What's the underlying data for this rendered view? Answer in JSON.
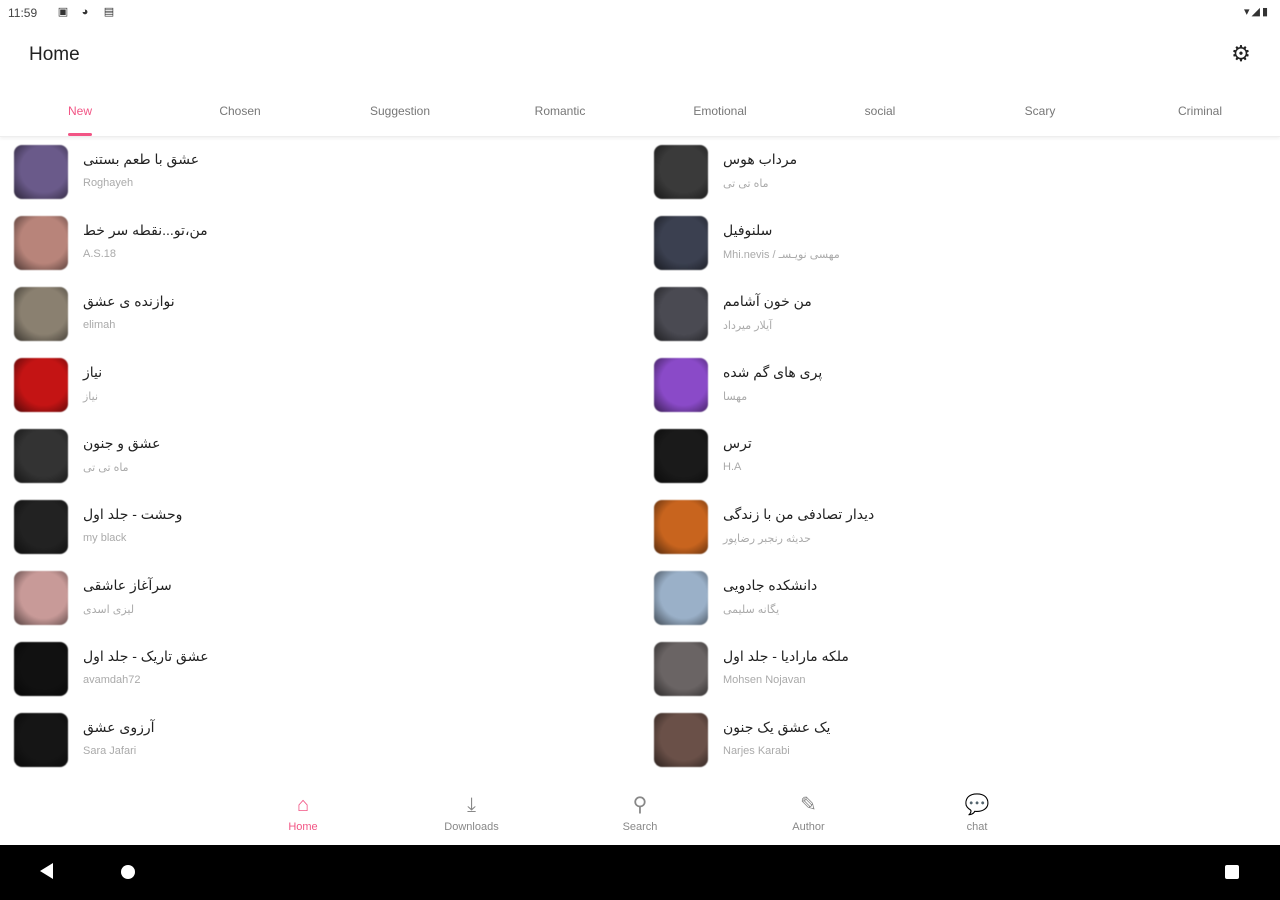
{
  "status": {
    "time": "11:59",
    "icons": [
      "notification-icon",
      "vpn-icon",
      "sim-icon"
    ],
    "right_icons": [
      "wifi-icon",
      "signal-icon",
      "battery-icon"
    ]
  },
  "appbar": {
    "title": "Home",
    "settings_icon": "gear-icon"
  },
  "tabs": [
    "New",
    "Chosen",
    "Suggestion",
    "Romantic",
    "Emotional",
    "social",
    "Scary",
    "Criminal"
  ],
  "active_tab": 0,
  "accent": "#f25585",
  "books_left": [
    {
      "title": "عشق با طعم بستنی",
      "author": "Roghayeh",
      "color": "#6a5a8a"
    },
    {
      "title": "من،تو...نقطه سر خط",
      "author": "A.S.18",
      "color": "#b8847a"
    },
    {
      "title": "نوازنده ی عشق",
      "author": "elimah",
      "color": "#8a8070"
    },
    {
      "title": "نیاز",
      "author": "نیاز",
      "color": "#c41414"
    },
    {
      "title": "عشق و جنون",
      "author": "ماه تی تی",
      "color": "#333333"
    },
    {
      "title": "وحشت - جلد اول",
      "author": "my black",
      "color": "#222222"
    },
    {
      "title": "سرآغاز عاشقی",
      "author": "لیزی اسدی",
      "color": "#c89a98"
    },
    {
      "title": "عشق تاریک - جلد اول",
      "author": "avamdah72",
      "color": "#111111"
    },
    {
      "title": "آرزوی عشق",
      "author": "Sara Jafari",
      "color": "#151515"
    }
  ],
  "books_right": [
    {
      "title": "مرداب هوس",
      "author": "ماه تی تی",
      "color": "#3a3a3a"
    },
    {
      "title": "سلنوفیل",
      "author": "Mhi.nevis / مهسی نویـسـ",
      "color": "#3b4050"
    },
    {
      "title": "من خون آشامم",
      "author": "آیلار میرداد",
      "color": "#4a4a52"
    },
    {
      "title": "پری های گم شده",
      "author": "مهسا",
      "color": "#8a4ac8"
    },
    {
      "title": "ترس",
      "author": "H.A",
      "color": "#1a1a1a"
    },
    {
      "title": "دیدار تصادفی من با زندگی",
      "author": "حدیثه رنجبر رضاپور",
      "color": "#c8641e"
    },
    {
      "title": "دانشکده جادویی",
      "author": "یگانه سلیمی",
      "color": "#9ab0c8"
    },
    {
      "title": "ملکه مارادیا - جلد اول",
      "author": "Mohsen Nojavan",
      "color": "#6a6464"
    },
    {
      "title": "یک عشق یک جنون",
      "author": "Narjes Karabi",
      "color": "#6a5048"
    }
  ],
  "bottom_nav": [
    {
      "label": "Home",
      "icon": "home-icon",
      "glyph": "⌂"
    },
    {
      "label": "Downloads",
      "icon": "download-icon",
      "glyph": "⤓"
    },
    {
      "label": "Search",
      "icon": "search-icon",
      "glyph": "⚲"
    },
    {
      "label": "Author",
      "icon": "author-icon",
      "glyph": "✎"
    },
    {
      "label": "chat",
      "icon": "chat-icon",
      "glyph": "💬"
    }
  ],
  "active_nav": 0
}
